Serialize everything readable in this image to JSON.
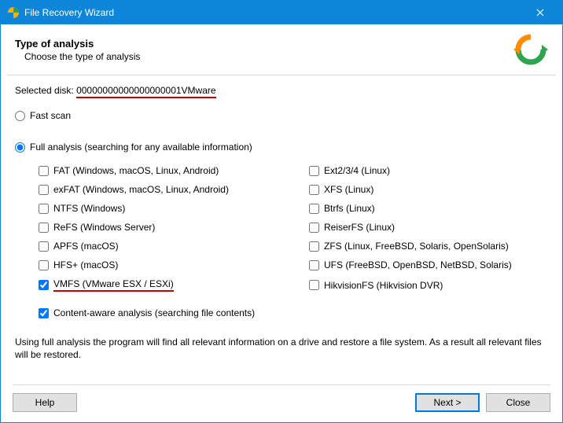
{
  "titlebar": {
    "title": "File Recovery Wizard"
  },
  "header": {
    "title": "Type of analysis",
    "subtitle": "Choose the type of analysis"
  },
  "selected_disk": {
    "label": "Selected disk:",
    "value": "00000000000000000001VMware"
  },
  "scan": {
    "fast_label": "Fast scan",
    "full_label": "Full analysis (searching for any available information)",
    "selected": "full"
  },
  "filesystems": {
    "left": [
      {
        "label": "FAT (Windows, macOS, Linux, Android)",
        "checked": false
      },
      {
        "label": "exFAT (Windows, macOS, Linux, Android)",
        "checked": false
      },
      {
        "label": "NTFS (Windows)",
        "checked": false
      },
      {
        "label": "ReFS (Windows Server)",
        "checked": false
      },
      {
        "label": "APFS (macOS)",
        "checked": false
      },
      {
        "label": "HFS+ (macOS)",
        "checked": false
      },
      {
        "label": "VMFS (VMware ESX / ESXi)",
        "checked": true,
        "underlined": true
      }
    ],
    "right": [
      {
        "label": "Ext2/3/4 (Linux)",
        "checked": false
      },
      {
        "label": "XFS (Linux)",
        "checked": false
      },
      {
        "label": "Btrfs (Linux)",
        "checked": false
      },
      {
        "label": "ReiserFS (Linux)",
        "checked": false
      },
      {
        "label": "ZFS (Linux, FreeBSD, Solaris, OpenSolaris)",
        "checked": false
      },
      {
        "label": "UFS (FreeBSD, OpenBSD, NetBSD, Solaris)",
        "checked": false
      },
      {
        "label": "HikvisionFS (Hikvision DVR)",
        "checked": false
      }
    ]
  },
  "content_aware": {
    "label": "Content-aware analysis (searching file contents)",
    "checked": true
  },
  "explain": "Using full analysis the program will find all relevant information on a drive and restore a file system. As a result all relevant files will be restored.",
  "footer": {
    "help": "Help",
    "next": "Next >",
    "close": "Close"
  }
}
